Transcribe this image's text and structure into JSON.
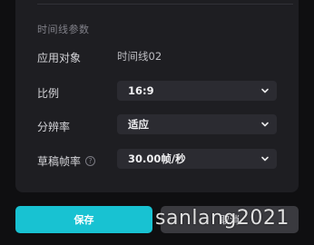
{
  "section": {
    "title": "时间线参数"
  },
  "rows": {
    "apply_target": {
      "label": "应用对象",
      "value": "时间线02"
    },
    "ratio": {
      "label": "比例",
      "value": "16:9"
    },
    "resolution": {
      "label": "分辨率",
      "value": "适应"
    },
    "draft_frame_rate": {
      "label": "草稿帧率",
      "value": "30.00帧/秒"
    }
  },
  "buttons": {
    "save": "保存",
    "cancel": "取消"
  },
  "watermark": "sanlang2021",
  "icons": {
    "help": "help-circle-icon",
    "dropdown": "chevron-down-icon"
  },
  "colors": {
    "accent": "#18c2d2",
    "panel": "#1e1e22",
    "select_bg": "#2b2b31"
  }
}
